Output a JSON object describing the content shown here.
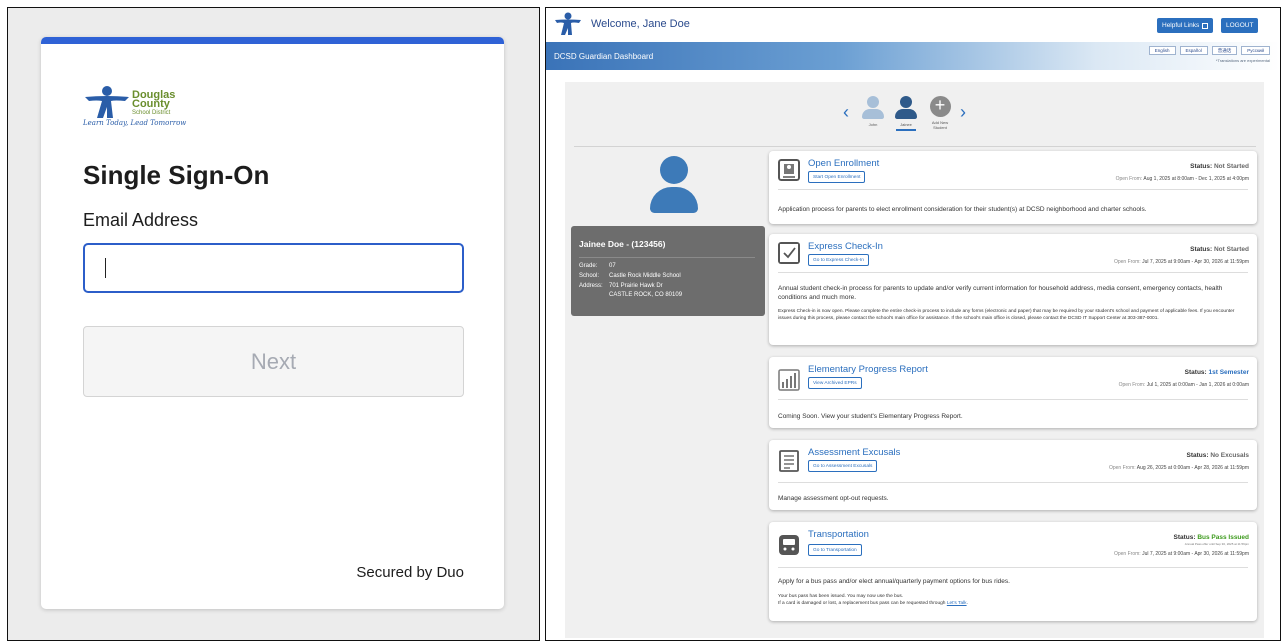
{
  "sso": {
    "logo": {
      "line1": "Douglas",
      "line2": "County",
      "line3": "School District",
      "tagline": "Learn Today, Lead Tomorrow"
    },
    "title": "Single Sign-On",
    "email_label": "Email Address",
    "email_value": "",
    "next_label": "Next",
    "secured_label": "Secured by Duo",
    "colors": {
      "accent": "#2f62d6",
      "logo_blue": "#2a5da8",
      "logo_green": "#6a8e2d"
    }
  },
  "dashboard": {
    "welcome": "Welcome, Jane Doe",
    "helpful_links": "Helpful Links",
    "logout": "LOGOUT",
    "banner_title": "DCSD Guardian Dashboard",
    "languages": [
      "English",
      "Español",
      "普通话",
      "Русский"
    ],
    "translations_note": "*Translations are experimental",
    "students": [
      {
        "name": "John",
        "selected": false
      },
      {
        "name": "Jainee",
        "selected": true
      }
    ],
    "add_student_label": "Add New Student",
    "add_student_line1": "Add New",
    "add_student_line2": "Student",
    "student_card": {
      "name": "Jainee Doe - (123456)",
      "grade_label": "Grade:",
      "grade": "07",
      "school_label": "School:",
      "school": "Castle Rock Middle School",
      "address_label": "Address:",
      "address_line1": "701 Prairie Hawk Dr",
      "address_line2": "CASTLE ROCK, CO 80109"
    },
    "cards": [
      {
        "title": "Open Enrollment",
        "button": "Start Open Enrollment",
        "status_label": "Status:",
        "status": "Not Started",
        "open_label": "Open From:",
        "open_range": "Aug 1, 2025 at 8:00am - Dec 1, 2025 at 4:00pm",
        "description": "Application process for parents to elect enrollment consideration for their student(s) at DCSD neighborhood and charter schools.",
        "icon": "enrollment-icon"
      },
      {
        "title": "Express Check-In",
        "button": "Go to Express Check-In",
        "status_label": "Status:",
        "status": "Not Started",
        "open_label": "Open From:",
        "open_range": "Jul 7, 2025 at 9:00am - Apr 30, 2026 at 11:59pm",
        "description": "Annual student check-in process for parents to update and/or verify current information for household address, media consent, emergency contacts, health conditions and much more.",
        "note": "Express Check-in is now open. Please complete the entire check-in process to include any forms (electronic and paper) that may be required by your student's school and payment of applicable fees. If you encounter issues during this process, please contact the school's main office for assistance. If the school's main office is closed, please contact the DCSD IT Support Center at 303-387-0001.",
        "icon": "checkbox-icon"
      },
      {
        "title": "Elementary Progress Report",
        "button": "View Archived EPRs",
        "status_label": "Status:",
        "status": "1st Semester",
        "open_label": "Open From:",
        "open_range": "Jul 1, 2025 at 0:00am - Jan 1, 2026 at 0:00am",
        "description": "Coming Soon. View your student's Elementary Progress Report.",
        "icon": "bar-chart-icon"
      },
      {
        "title": "Assessment Excusals",
        "button": "Go to Assessment Excusals",
        "status_label": "Status:",
        "status": "No Excusals",
        "open_label": "Open From:",
        "open_range": "Aug 26, 2025 at 0:00am - Apr 28, 2026 at 11:59pm",
        "description": "Manage assessment opt-out requests.",
        "icon": "document-icon"
      },
      {
        "title": "Transportation",
        "button": "Go to Transportation",
        "status_label": "Status:",
        "status": "Bus Pass Issued",
        "status_sub": "Annual Pass offer until Sep 30, 2025 at 11:59pm",
        "open_label": "Open From:",
        "open_range": "Jul 7, 2025 at 9:00am - Apr 30, 2026 at 11:59pm",
        "description": "Apply for a bus pass and/or elect annual/quarterly payment options for bus rides.",
        "note_line1": "Your bus pass has been issued. You may now use the bus.",
        "note_line2": "If a card is damaged or lost, a replacement bus pass can be requested through",
        "note_link": "Let's Talk",
        "note_end": ".",
        "icon": "bus-icon"
      }
    ],
    "colors": {
      "primary": "#2b6fbe",
      "avatar": "#3d7ab8",
      "status_green": "#3c9a1c"
    }
  }
}
